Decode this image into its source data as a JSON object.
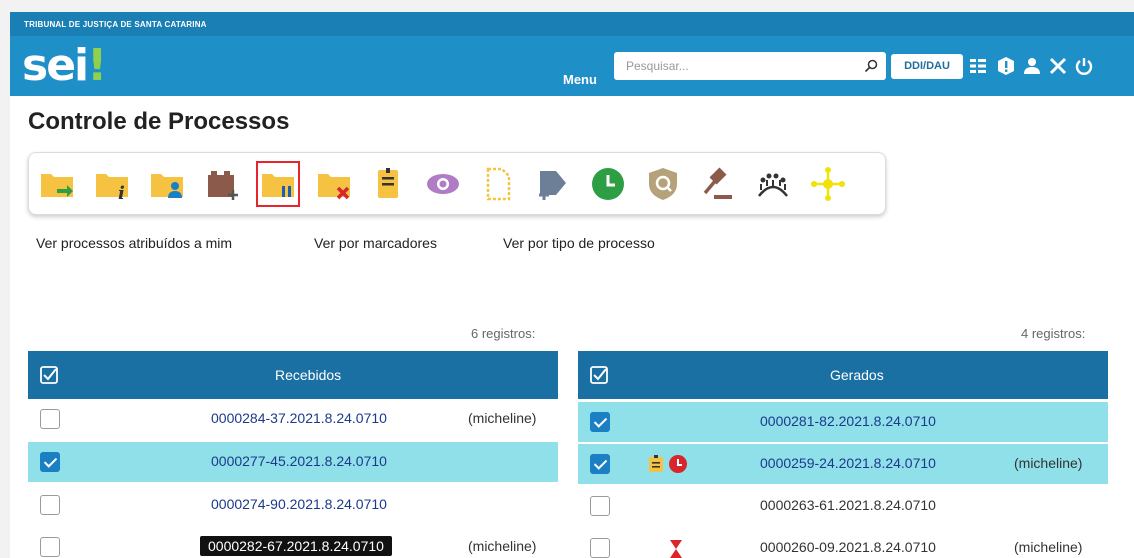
{
  "header": {
    "organization": "TRIBUNAL DE JUSTIÇA DE SANTA CATARINA",
    "logo_text": "sei",
    "logo_mark": "!",
    "menu_label": "Menu",
    "search_placeholder": "Pesquisar...",
    "unit_label": "DDI/DAU",
    "icons": [
      "grid-icon",
      "alert-icon",
      "user-icon",
      "tools-icon",
      "power-icon"
    ]
  },
  "page_title": "Controle de Processos",
  "toolbar": {
    "buttons": [
      {
        "name": "send-process-icon",
        "color": "#f5c242"
      },
      {
        "name": "process-info-icon",
        "color": "#f5c242"
      },
      {
        "name": "assign-process-icon",
        "color": "#f5c242"
      },
      {
        "name": "add-block-icon",
        "color": "#8b5a4a"
      },
      {
        "name": "suspend-process-icon",
        "color": "#f5c242",
        "selected": true
      },
      {
        "name": "close-process-icon",
        "color": "#f5c242"
      },
      {
        "name": "annotation-icon",
        "color": "#f5c242"
      },
      {
        "name": "view-icon",
        "color": "#b07cc6"
      },
      {
        "name": "new-document-icon",
        "color": "#f5c242"
      },
      {
        "name": "add-marker-icon",
        "color": "#6d7f96"
      },
      {
        "name": "deadline-control-icon",
        "color": "#2e9e45"
      },
      {
        "name": "search-process-icon",
        "color": "#b5a27a"
      },
      {
        "name": "judgment-icon",
        "color": "#8b5a4a"
      },
      {
        "name": "session-icon",
        "color": "#333333"
      },
      {
        "name": "fluxo-icon",
        "color": "#f2e20b"
      }
    ]
  },
  "nav_links": [
    "Ver processos atribuídos a mim",
    "Ver por marcadores",
    "Ver por tipo de processo"
  ],
  "received": {
    "count_label": "6 registros:",
    "title": "Recebidos",
    "rows": [
      {
        "number": "0000284-37.2021.8.24.0710",
        "user": "(micheline)",
        "checked": false
      },
      {
        "number": "0000277-45.2021.8.24.0710",
        "user": "",
        "checked": true
      },
      {
        "number": "0000274-90.2021.8.24.0710",
        "user": "",
        "checked": false
      },
      {
        "number": "0000282-67.2021.8.24.0710",
        "user": "(micheline)",
        "checked": false
      }
    ]
  },
  "generated": {
    "count_label": "4 registros:",
    "title": "Gerados",
    "rows": [
      {
        "number": "0000281-82.2021.8.24.0710",
        "user": "",
        "checked": true
      },
      {
        "number": "0000259-24.2021.8.24.0710",
        "user": "(micheline)",
        "checked": true
      },
      {
        "number": "0000263-61.2021.8.24.0710",
        "user": "",
        "checked": false
      },
      {
        "number": "0000260-09.2021.8.24.0710",
        "user": "(micheline)",
        "checked": false
      }
    ]
  },
  "colors": {
    "header": "#1f8fc8",
    "table_header": "#1a6fa3",
    "selected_row": "#8fe0e8",
    "link": "#1c3a8c",
    "highlight_border": "#e8242c"
  }
}
